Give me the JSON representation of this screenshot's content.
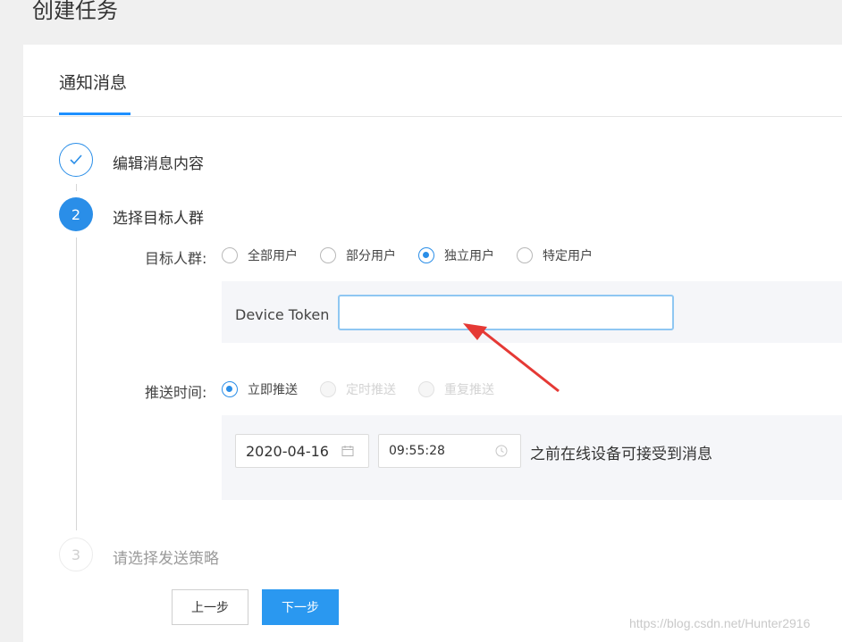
{
  "page": {
    "title": "创建任务"
  },
  "tabs": [
    {
      "label": "通知消息",
      "active": true
    }
  ],
  "steps": [
    {
      "number": "",
      "label": "编辑消息内容",
      "status": "done"
    },
    {
      "number": "2",
      "label": "选择目标人群",
      "status": "active"
    },
    {
      "number": "3",
      "label": "请选择发送策略",
      "status": "wait"
    }
  ],
  "target": {
    "label": "目标人群:",
    "options": [
      "全部用户",
      "部分用户",
      "独立用户",
      "特定用户"
    ],
    "selected": "独立用户",
    "token_label": "Device Token",
    "token_value": ""
  },
  "push_time": {
    "label": "推送时间:",
    "options": [
      "立即推送",
      "定时推送",
      "重复推送"
    ],
    "selected": "立即推送",
    "date": "2020-04-16",
    "time": "09:55:28",
    "suffix": "之前在线设备可接受到消息"
  },
  "buttons": {
    "prev": "上一步",
    "next": "下一步"
  },
  "watermark": "https://blog.csdn.net/Hunter2916",
  "colors": {
    "accent": "#2a8ee8",
    "panel": "#f5f6f9",
    "arrow": "#e53935"
  }
}
